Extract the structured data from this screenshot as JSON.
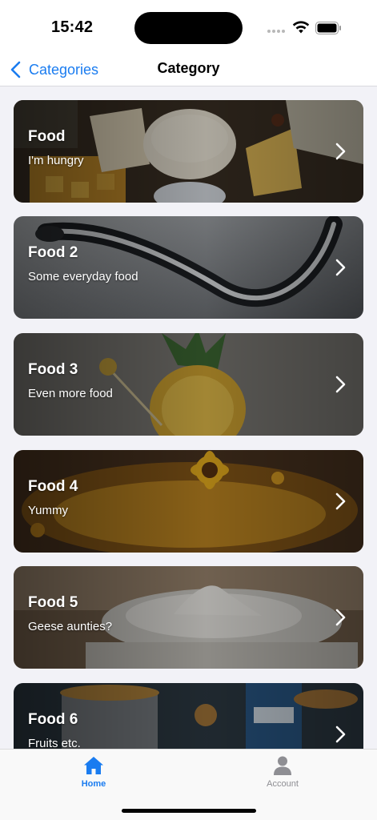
{
  "status_bar": {
    "time": "15:42",
    "icons": [
      "signal-icon",
      "wifi-icon",
      "battery-icon"
    ]
  },
  "nav": {
    "back_label": "Categories",
    "title": "Category",
    "accent_color": "#1A7CF0"
  },
  "categories": [
    {
      "title": "Food",
      "subtitle": "I'm hungry",
      "image": "cheese-board"
    },
    {
      "title": "Food 2",
      "subtitle": "Some everyday food",
      "image": "chrome-spoon"
    },
    {
      "title": "Food 3",
      "subtitle": "Even more food",
      "image": "pineapple"
    },
    {
      "title": "Food 4",
      "subtitle": "Yummy",
      "image": "sunflower-honey"
    },
    {
      "title": "Food 5",
      "subtitle": "Geese aunties?",
      "image": "cream-bowl"
    },
    {
      "title": "Food 6",
      "subtitle": "Fruits etc.",
      "image": "grain-buckets"
    }
  ],
  "tabs": [
    {
      "label": "Home",
      "icon": "house-icon",
      "selected": true
    },
    {
      "label": "Account",
      "icon": "person-icon",
      "selected": false
    }
  ]
}
